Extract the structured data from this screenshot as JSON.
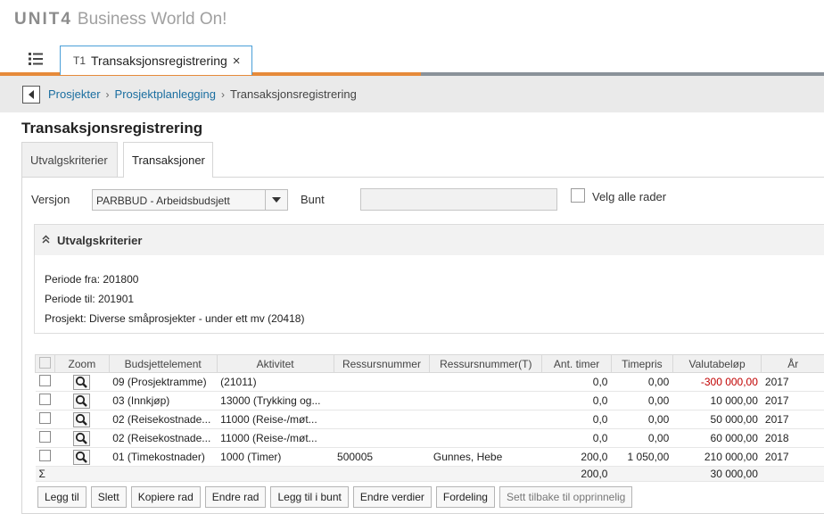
{
  "app": {
    "brand": "UNIT4",
    "product": "Business World On!"
  },
  "tab": {
    "code": "T1",
    "title": "Transaksjonsregistrering",
    "close": "×"
  },
  "breadcrumb": {
    "items": [
      "Prosjekter",
      "Prosjektplanlegging"
    ],
    "current": "Transaksjonsregistrering",
    "separator": "›"
  },
  "page": {
    "title": "Transaksjonsregistrering"
  },
  "subtabs": [
    "Utvalgskriterier",
    "Transaksjoner"
  ],
  "form": {
    "versjon_label": "Versjon",
    "versjon_value": "PARBBUD - Arbeidsbudsjett",
    "bunt_label": "Bunt",
    "bunt_value": "",
    "velg_alle_label": "Velg alle rader"
  },
  "utvalg": {
    "title": "Utvalgskriterier",
    "lines": [
      "Periode fra: 201800",
      "Periode til: 201901",
      "Prosjekt: Diverse småprosjekter - under ett mv (20418)"
    ]
  },
  "grid": {
    "columns": [
      "Zoom",
      "Budsjettelement",
      "Aktivitet",
      "Ressursnummer",
      "Ressursnummer(T)",
      "Ant. timer",
      "Timepris",
      "Valutabeløp",
      "År"
    ],
    "rows": [
      {
        "budsjettelement": "09 (Prosjektramme)",
        "aktivitet": "(21011)",
        "ressursnummer": "",
        "ressursnummer_t": "",
        "ant_timer": "0,0",
        "timepris": "0,00",
        "valutabelop": "-300 000,00",
        "ar": "2017"
      },
      {
        "budsjettelement": "03 (Innkjøp)",
        "aktivitet": "13000 (Trykking og...",
        "ressursnummer": "",
        "ressursnummer_t": "",
        "ant_timer": "0,0",
        "timepris": "0,00",
        "valutabelop": "10 000,00",
        "ar": "2017"
      },
      {
        "budsjettelement": "02 (Reisekostnade...",
        "aktivitet": "11000 (Reise-/møt...",
        "ressursnummer": "",
        "ressursnummer_t": "",
        "ant_timer": "0,0",
        "timepris": "0,00",
        "valutabelop": "50 000,00",
        "ar": "2017"
      },
      {
        "budsjettelement": "02 (Reisekostnade...",
        "aktivitet": "11000 (Reise-/møt...",
        "ressursnummer": "",
        "ressursnummer_t": "",
        "ant_timer": "0,0",
        "timepris": "0,00",
        "valutabelop": "60 000,00",
        "ar": "2018"
      },
      {
        "budsjettelement": "01 (Timekostnader)",
        "aktivitet": "1000 (Timer)",
        "ressursnummer": "500005",
        "ressursnummer_t": "Gunnes, Hebe",
        "ant_timer": "200,0",
        "timepris": "1 050,00",
        "valutabelop": "210 000,00",
        "ar": "2017"
      }
    ],
    "sum": {
      "symbol": "Σ",
      "ant_timer": "200,0",
      "valutabelop": "30 000,00"
    }
  },
  "buttons": [
    "Legg til",
    "Slett",
    "Kopiere rad",
    "Endre rad",
    "Legg til i bunt",
    "Endre verdier",
    "Fordeling",
    "Sett tilbake til opprinnelig"
  ],
  "colors": {
    "accent_orange": "#e68a3a",
    "link_blue": "#1a6ea0",
    "negative_red": "#c00000",
    "tab_border": "#4a9fd8"
  }
}
